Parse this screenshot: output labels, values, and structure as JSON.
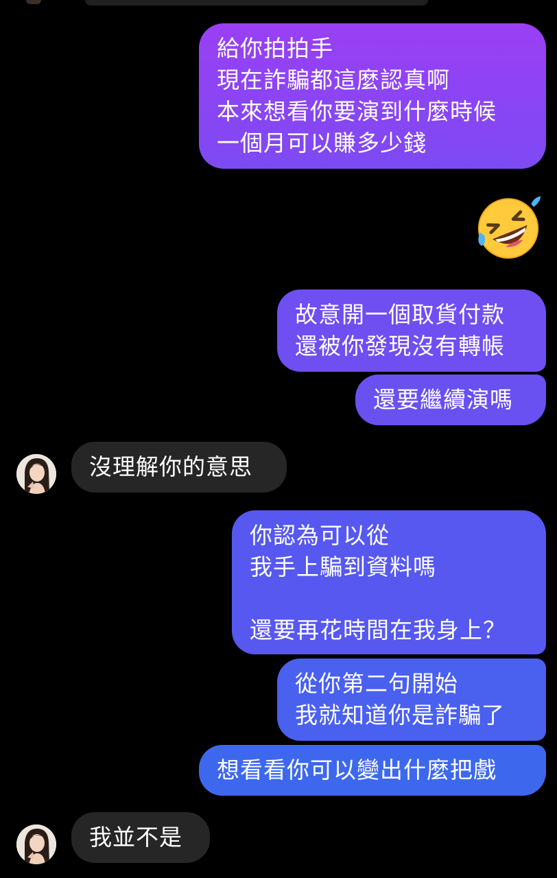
{
  "conversation": {
    "messages": [
      {
        "sender": "me",
        "text": "給你拍拍手\n現在詐騙都這麼認真啊\n本來想看你要演到什麼時候\n一個月可以賺多少錢"
      },
      {
        "sender": "me",
        "emoji": "rolling-on-the-floor-laughing"
      },
      {
        "sender": "me",
        "text": "故意開一個取貨付款\n還被你發現沒有轉帳"
      },
      {
        "sender": "me",
        "text": "還要繼續演嗎"
      },
      {
        "sender": "other",
        "text": "沒理解你的意思"
      },
      {
        "sender": "me",
        "text": "你認為可以從\n我手上騙到資料嗎\n\n還要再花時間在我身上？"
      },
      {
        "sender": "me",
        "text": "從你第二句開始\n我就知道你是詐騙了"
      },
      {
        "sender": "me",
        "text": "想看看你可以變出什麼把戲"
      },
      {
        "sender": "other",
        "text": "我並不是"
      }
    ]
  },
  "colors": {
    "background": "#000000",
    "incoming_bubble": "#262626",
    "outgoing_gradient_top": "#9a3ff4",
    "outgoing_gradient_bottom": "#3d68ee"
  }
}
